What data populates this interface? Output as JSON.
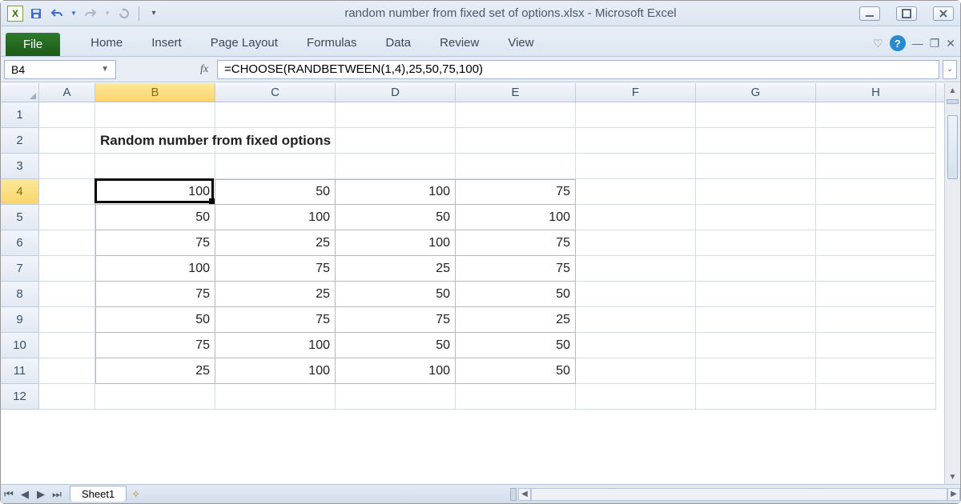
{
  "window": {
    "title": "random number from fixed set of options.xlsx  -  Microsoft Excel"
  },
  "ribbon": {
    "file": "File",
    "tabs": [
      "Home",
      "Insert",
      "Page Layout",
      "Formulas",
      "Data",
      "Review",
      "View"
    ]
  },
  "namebox": {
    "value": "B4"
  },
  "formula": {
    "value": "=CHOOSE(RANDBETWEEN(1,4),25,50,75,100)"
  },
  "columns": [
    "A",
    "B",
    "C",
    "D",
    "E",
    "F",
    "G",
    "H"
  ],
  "row_numbers": [
    "1",
    "2",
    "3",
    "4",
    "5",
    "6",
    "7",
    "8",
    "9",
    "10",
    "11",
    "12"
  ],
  "heading_text": "Random number from fixed options",
  "table": {
    "rows": [
      {
        "B": "100",
        "C": "50",
        "D": "100",
        "E": "75"
      },
      {
        "B": "50",
        "C": "100",
        "D": "50",
        "E": "100"
      },
      {
        "B": "75",
        "C": "25",
        "D": "100",
        "E": "75"
      },
      {
        "B": "100",
        "C": "75",
        "D": "25",
        "E": "75"
      },
      {
        "B": "75",
        "C": "25",
        "D": "50",
        "E": "50"
      },
      {
        "B": "50",
        "C": "75",
        "D": "75",
        "E": "25"
      },
      {
        "B": "75",
        "C": "100",
        "D": "50",
        "E": "50"
      },
      {
        "B": "25",
        "C": "100",
        "D": "100",
        "E": "50"
      }
    ]
  },
  "sheet": {
    "name": "Sheet1"
  },
  "active_cell": "B4",
  "selected_column": "B",
  "selected_row": "4"
}
